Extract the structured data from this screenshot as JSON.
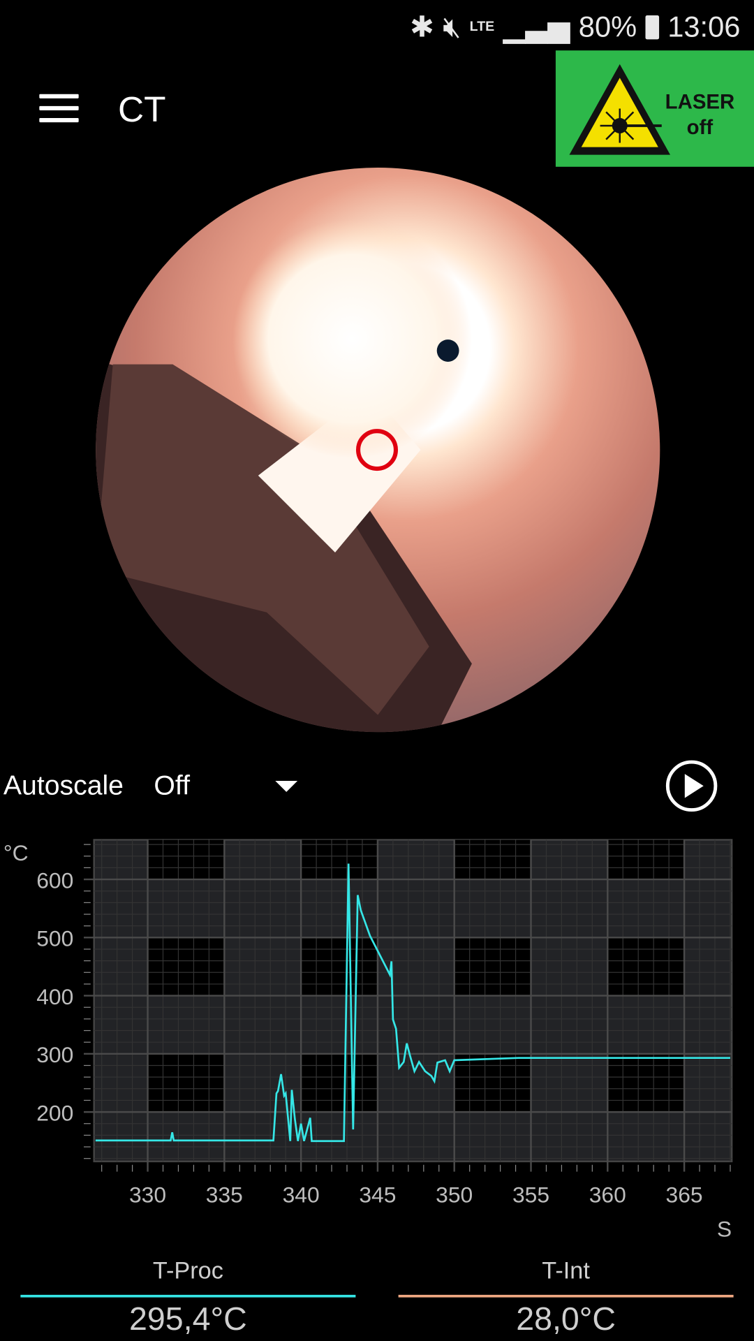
{
  "status_bar": {
    "icons": [
      "bluetooth-icon",
      "mute-icon",
      "lte-icon",
      "signal-icon",
      "battery-icon"
    ],
    "lte": "LTE",
    "battery": "80%",
    "time": "13:06"
  },
  "header": {
    "title": "CT",
    "menu_icon": "hamburger-icon"
  },
  "laser_badge": {
    "line1": "LASER",
    "line2": "off",
    "color": "#2db84a"
  },
  "controls": {
    "autoscale_label": "Autoscale",
    "autoscale_value": "Off",
    "play_icon": "play-circle-icon"
  },
  "chart_data": {
    "type": "line",
    "ylabel": "°C",
    "xlabel": "S",
    "xlim": [
      326.5,
      368.1
    ],
    "ylim": [
      115,
      668
    ],
    "x_ticks": [
      330,
      335,
      340,
      345,
      350,
      355,
      360,
      365
    ],
    "y_ticks": [
      200,
      300,
      400,
      500,
      600
    ],
    "grid": true,
    "series": [
      {
        "color": "#35e6e6",
        "points": [
          [
            326.6,
            151
          ],
          [
            331.5,
            151
          ],
          [
            331.6,
            165
          ],
          [
            331.7,
            151
          ],
          [
            338.2,
            151
          ],
          [
            338.4,
            232
          ],
          [
            338.5,
            236
          ],
          [
            338.7,
            265
          ],
          [
            338.9,
            228
          ],
          [
            339.0,
            232
          ],
          [
            339.3,
            150
          ],
          [
            339.4,
            238
          ],
          [
            339.6,
            188
          ],
          [
            339.8,
            150
          ],
          [
            340.0,
            180
          ],
          [
            340.2,
            150
          ],
          [
            340.6,
            190
          ],
          [
            340.7,
            150
          ],
          [
            342.8,
            150
          ],
          [
            343.1,
            627
          ],
          [
            343.4,
            170
          ],
          [
            343.7,
            573
          ],
          [
            343.9,
            547
          ],
          [
            344.5,
            503
          ],
          [
            345.8,
            436
          ],
          [
            345.9,
            459
          ],
          [
            346.0,
            359
          ],
          [
            346.2,
            343
          ],
          [
            346.4,
            276
          ],
          [
            346.7,
            286
          ],
          [
            346.9,
            318
          ],
          [
            347.1,
            298
          ],
          [
            347.4,
            270
          ],
          [
            347.7,
            286
          ],
          [
            348.1,
            270
          ],
          [
            348.5,
            262
          ],
          [
            348.7,
            253
          ],
          [
            348.9,
            285
          ],
          [
            349.4,
            289
          ],
          [
            349.7,
            270
          ],
          [
            350.0,
            289
          ],
          [
            354.2,
            293
          ],
          [
            360,
            293
          ],
          [
            368,
            293
          ]
        ]
      }
    ]
  },
  "legend": [
    {
      "label": "T-Proc",
      "value": "295,4°C",
      "color": "#35e6e6"
    },
    {
      "label": "T-Int",
      "value": "28,0°C",
      "color": "#f0a882"
    }
  ]
}
